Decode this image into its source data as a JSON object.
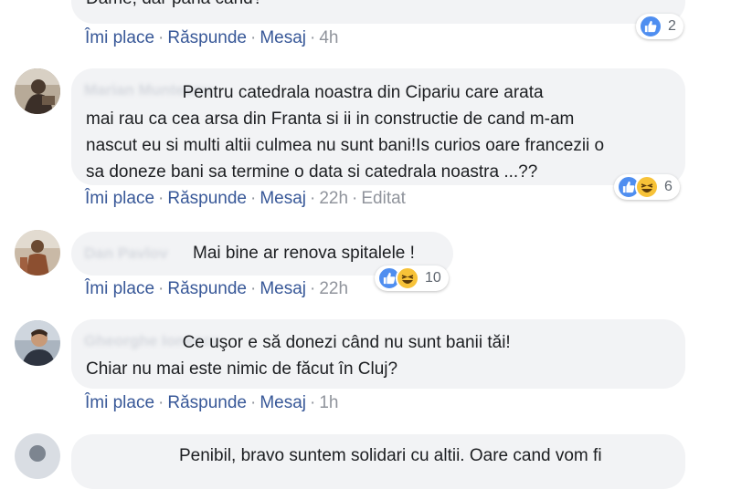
{
  "comments": [
    {
      "text": "Dame, dar pana cand?",
      "actions": {
        "like": "Îmi place",
        "reply": "Răspunde",
        "message": "Mesaj",
        "time": "4h"
      },
      "reactions": {
        "icons": [
          "like"
        ],
        "count": "2"
      }
    },
    {
      "author": "Marian Munteanu",
      "text": "                    Pentru catedrala noastra din Cipariu care arata\nmai rau ca cea arsa din Franta si ii in constructie de cand m-am\nnascut eu si multi altii culmea nu sunt bani!Is curios oare francezii o\nsa doneze bani sa termine o data si catedrala noastra ...??",
      "actions": {
        "like": "Îmi place",
        "reply": "Răspunde",
        "message": "Mesaj",
        "time": "22h",
        "edited": "Editat"
      },
      "reactions": {
        "icons": [
          "like",
          "haha"
        ],
        "count": "6"
      }
    },
    {
      "author": "Dan Pavlov",
      "text": "Mai bine ar renova spitalele !",
      "actions": {
        "like": "Îmi place",
        "reply": "Răspunde",
        "message": "Mesaj",
        "time": "22h"
      },
      "reactions": {
        "icons": [
          "like",
          "haha"
        ],
        "count": "10"
      }
    },
    {
      "author": "Gheorghe Ionescu",
      "text": "                    Ce uşor e să donezi când nu sunt banii tăi!\nChiar nu mai este nimic de făcut în Cluj?",
      "actions": {
        "like": "Îmi place",
        "reply": "Răspunde",
        "message": "Mesaj",
        "time": "1h"
      }
    },
    {
      "text": "Penibil, bravo suntem solidari cu altii. Oare cand vom fi"
    }
  ],
  "colors": {
    "link": "#385898",
    "meta": "#90949c",
    "bubble": "#f2f3f5",
    "like": "#4f8ef0",
    "haha": "#f7c238"
  }
}
